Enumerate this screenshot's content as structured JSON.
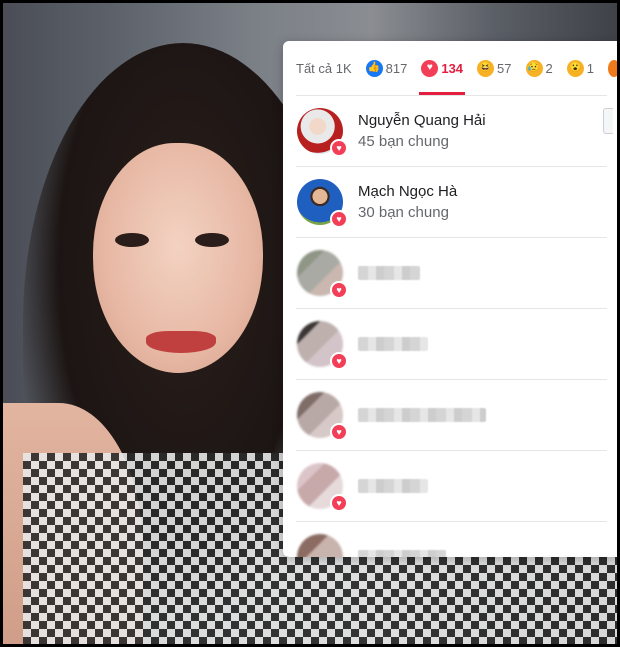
{
  "tabs": [
    {
      "label": "Tất cả 1K",
      "icon": null
    },
    {
      "label": "817",
      "icon": "like-icon"
    },
    {
      "label": "134",
      "icon": "love-icon",
      "active": true
    },
    {
      "label": "57",
      "icon": "haha-icon"
    },
    {
      "label": "2",
      "icon": "sad-icon"
    },
    {
      "label": "1",
      "icon": "wow-icon"
    }
  ],
  "people": [
    {
      "name": "Nguyễn Quang Hải",
      "mutual": "45 bạn chung"
    },
    {
      "name": "Mạch Ngọc Hà",
      "mutual": "30 bạn chung"
    }
  ],
  "colors": {
    "accent": "#e41e3f",
    "love": "#f33e58",
    "like": "#1877f2"
  }
}
